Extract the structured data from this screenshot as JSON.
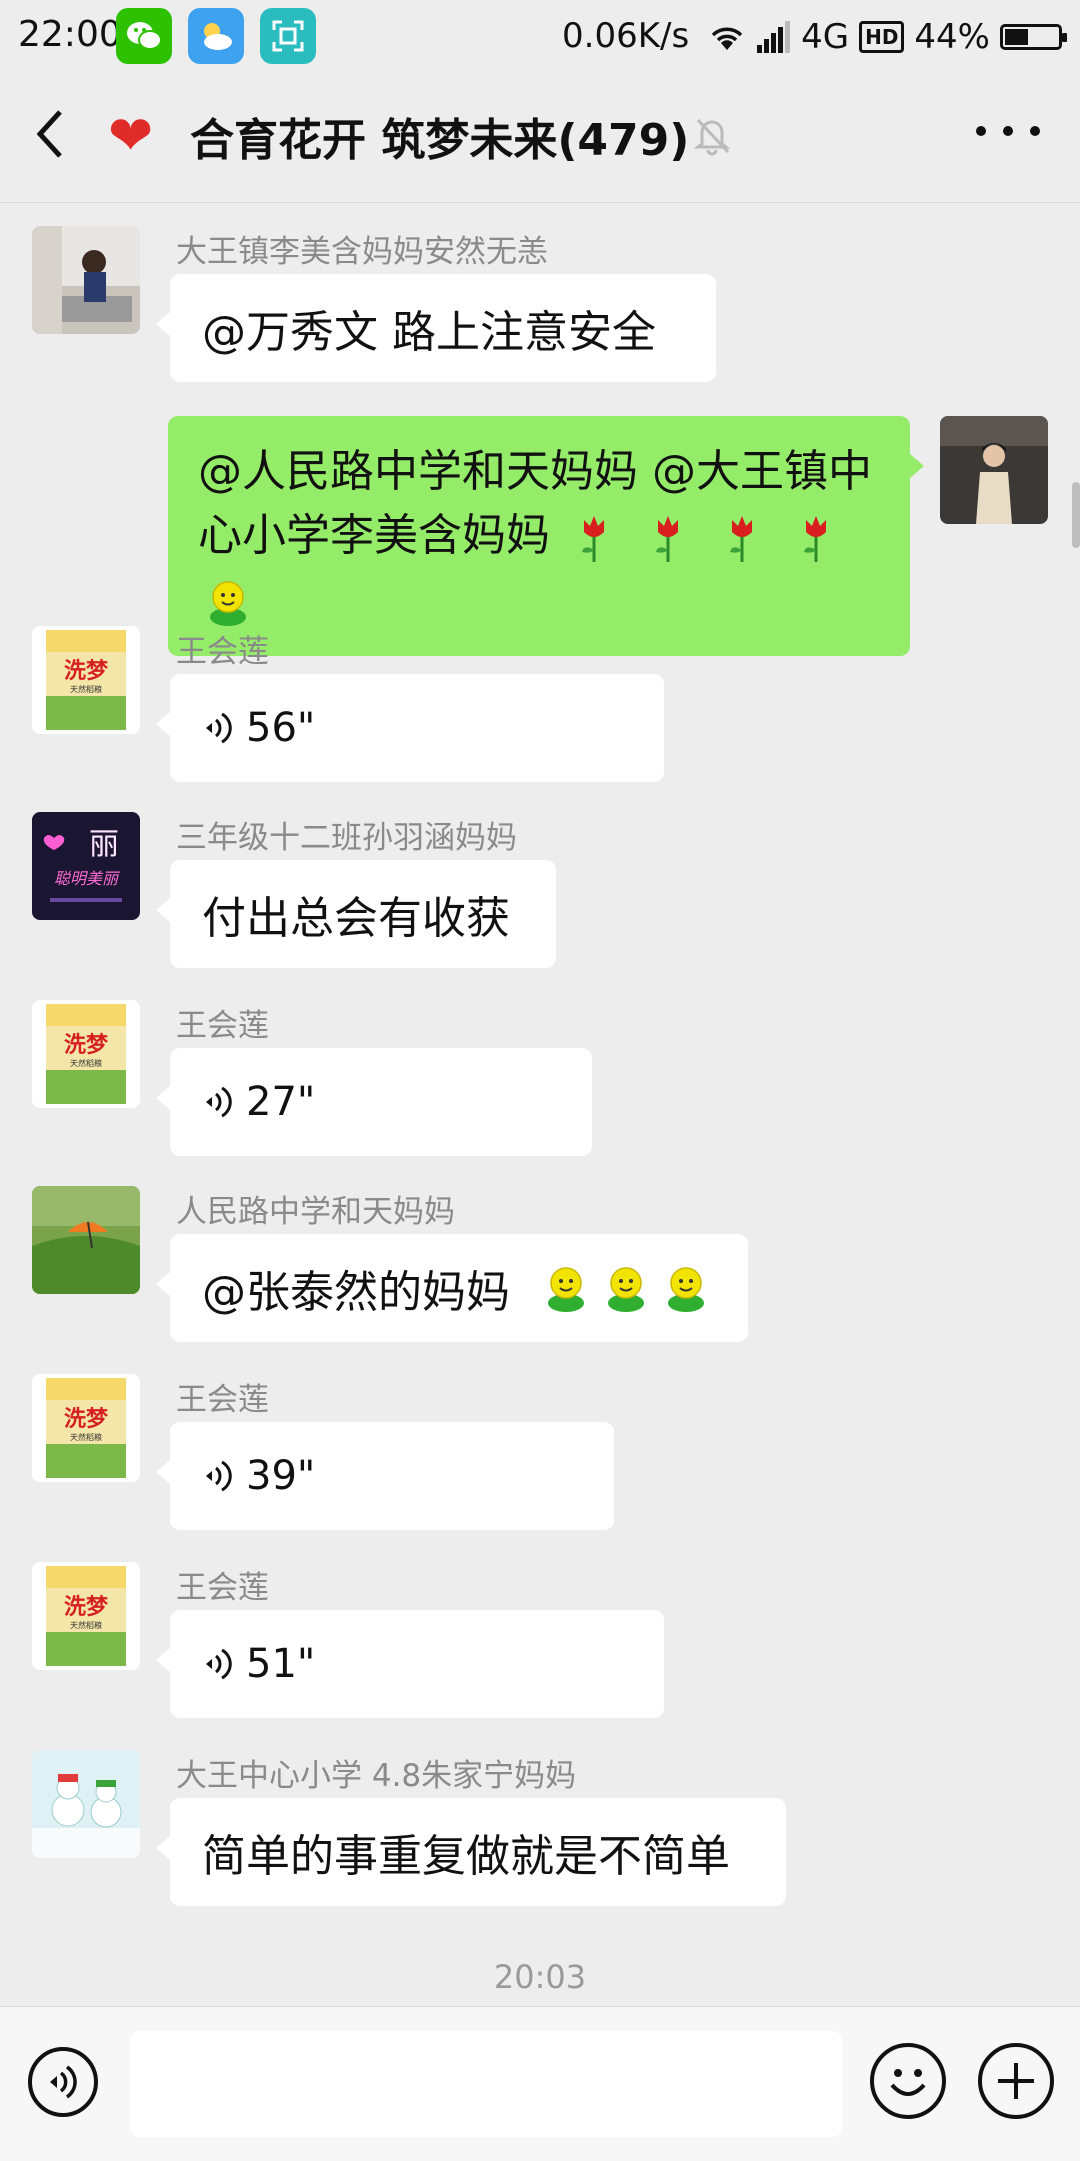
{
  "status_bar": {
    "time": "22:00",
    "speed": "0.06K/s",
    "network": "4G",
    "hd": "HD",
    "battery": "44%",
    "battery_level": 0.44,
    "apps": [
      "wechat-icon",
      "weather-icon",
      "scan-icon"
    ]
  },
  "header": {
    "back_icon": "chevron-left-icon",
    "heart": "❤",
    "title": "合育花开 筑梦未来(479)",
    "mute_icon": "bell-off-icon",
    "more_icon": "more-dots-icon"
  },
  "messages": [
    {
      "type": "text",
      "sender": "大王镇李美含妈妈安然无恙",
      "text": "@万秀文  路上注意安全"
    },
    {
      "type": "sent",
      "text": "@人民路中学和天妈妈 @大王镇中心小学李美含妈妈",
      "emojis": [
        "rose",
        "rose",
        "rose",
        "rose",
        "smiley"
      ]
    },
    {
      "type": "voice",
      "sender": "王会莲",
      "duration": "56\""
    },
    {
      "type": "text",
      "sender": "三年级十二班孙羽涵妈妈",
      "text": "付出总会有收获"
    },
    {
      "type": "voice",
      "sender": "王会莲",
      "duration": "27\""
    },
    {
      "type": "text",
      "sender": "人民路中学和天妈妈",
      "text": "@张泰然的妈妈",
      "emojis": [
        "smiley",
        "smiley",
        "smiley"
      ]
    },
    {
      "type": "voice",
      "sender": "王会莲",
      "duration": "39\""
    },
    {
      "type": "voice",
      "sender": "王会莲",
      "duration": "51\""
    },
    {
      "type": "text",
      "sender": "大王中心小学 4.8朱家宁妈妈",
      "text": "简单的事重复做就是不简单"
    }
  ],
  "avatar_images": {
    "lmh": "lmh",
    "rice_bag_text": "洗梦",
    "rice_bag_small": "天然稻粮",
    "li_text": "丽",
    "li_script": "聪明美丽"
  },
  "timestamp": "20:03",
  "input_bar": {
    "voice_icon": "voice-mode-icon",
    "input_value": "",
    "emoji_icon": "emoji-icon",
    "plus_icon": "plus-icon"
  },
  "colors": {
    "background": "#ededed",
    "sent_bubble": "#95ec69",
    "received_bubble": "#ffffff",
    "sender_name": "#8a8a8a"
  }
}
